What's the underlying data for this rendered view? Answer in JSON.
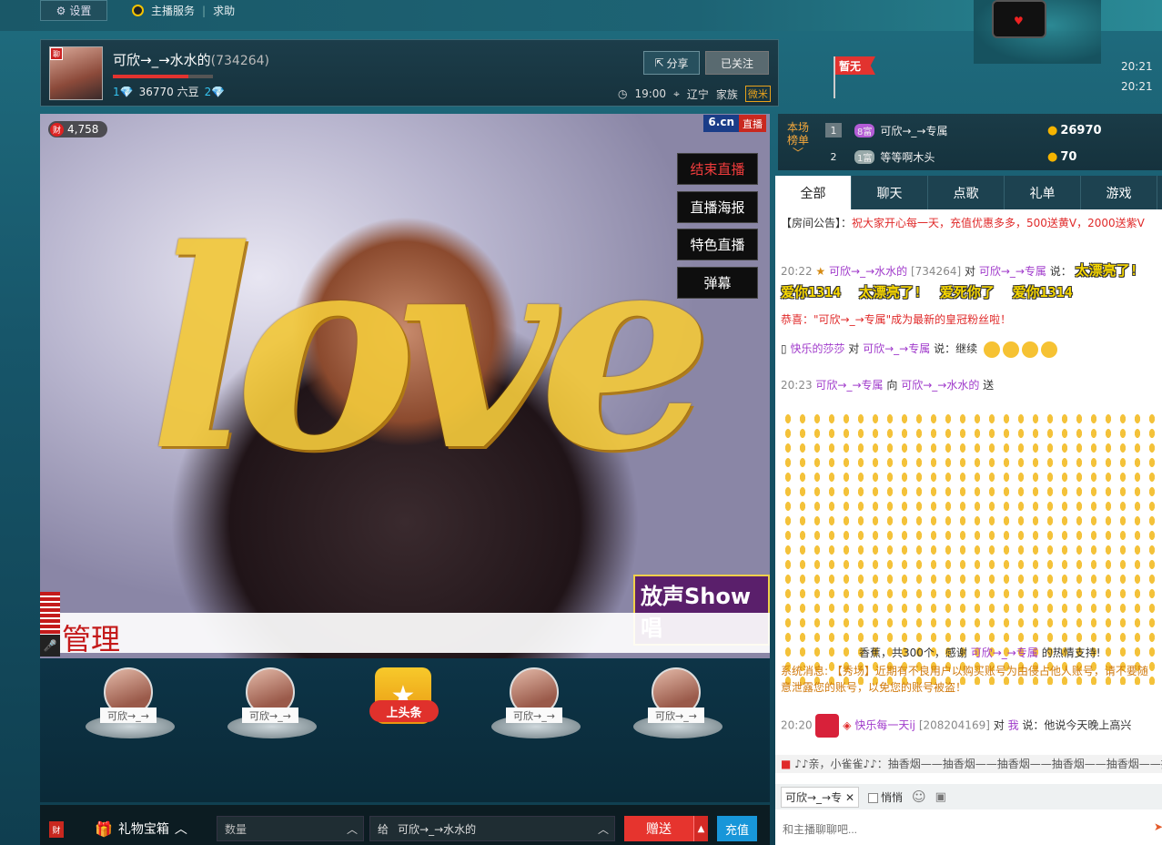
{
  "topbar": {
    "settings_label": "设置",
    "links": [
      "主播服务",
      "求助"
    ]
  },
  "host": {
    "avatar_badge": "聊",
    "name": "可欣→_→水水的",
    "id": "(734264)",
    "level_progress": 0.75,
    "beans": "36770 六豆",
    "share_label": "分享",
    "follow_label": "已关注",
    "time": "19:00",
    "location": "辽宁",
    "family_label": "家族",
    "family_tag": "微米"
  },
  "status": {
    "flag": "暂无",
    "times": [
      "20:21",
      "20:21"
    ]
  },
  "video": {
    "wealth_icon": "财",
    "wealth": "4,758",
    "site": "6.cn",
    "live_tag": "直播",
    "buttons": [
      "结束直播",
      "直播海报",
      "特色直播",
      "弹幕"
    ],
    "overlay_word": "love",
    "manage_text": "管理",
    "show_logo": "放声Show唱"
  },
  "seats": {
    "labels": [
      "可欣→_→",
      "可欣→_→",
      "可欣→_→",
      "可欣→_→"
    ],
    "headline": "上头条"
  },
  "giftbar": {
    "red_icon": "财",
    "box_label": "礼物宝箱",
    "qty_placeholder": "数量",
    "to_prefix": "给",
    "to_target": "可欣→_→水水的",
    "send_label": "赠送",
    "charge_label": "充值"
  },
  "rank": {
    "title": "本场榜单",
    "rows": [
      {
        "no": "1",
        "vip": "8富",
        "name": "可欣→_→专属",
        "value": "26970"
      },
      {
        "no": "2",
        "vip": "1富",
        "name": "等等啊木头",
        "value": "70"
      }
    ]
  },
  "chat": {
    "tabs": [
      "全部",
      "聊天",
      "点歌",
      "礼单",
      "游戏"
    ],
    "notice_prefix": "【房间公告】：",
    "notice": "祝大家开心每一天，充值优惠多多，500送黄V，2000送紫V",
    "msg1": {
      "time": "20:22",
      "from": "可欣→_→水水的",
      "from_id": "[734264]",
      "to_word": "对",
      "to": "可欣→_→专属",
      "say": "说：",
      "text1": "太漂亮了!",
      "line2": [
        "爱你1314",
        "太漂亮了!",
        "爱死你了",
        "爱你1314"
      ]
    },
    "crown_msg": "恭喜：\"可欣→_→专属\"成为最新的皇冠粉丝啦！",
    "msg2": {
      "from": "快乐的莎莎",
      "to_word": "对",
      "to": "可欣→_→专属",
      "say": "说：继续"
    },
    "gift_msg": {
      "time": "20:23",
      "from": "可欣→_→专属",
      "to_word": "向",
      "to": "可欣→_→水水的",
      "send": "送"
    },
    "gift_summary": {
      "item": "香蕉，共300个，感谢",
      "who": "可欣→_→专属",
      "tail": "的热情支持!"
    },
    "system_msg": "系统消息: 【秀场】近期有不良用户以购买账号为由侵占他人账号，请不要随意泄露您的账号，以免您的账号被盗！",
    "msg3": {
      "time": "20:20",
      "from": "快乐每一天ij",
      "from_id": "[208204169]",
      "to_word": "对",
      "to": "我",
      "say": "说：他说今天晚上高兴"
    },
    "marquee": "♪♪亲，小雀雀♪♪：抽香烟——抽香烟——抽香烟——抽香烟——抽香烟——抽香烟",
    "to_chip": "可欣→_→专",
    "whisper_label": "悄悄",
    "input_placeholder": "和主播聊聊吧..."
  },
  "colors": {
    "accent_red": "#e6342e",
    "charge_blue": "#1896d9",
    "rank_gold": "#f8a93b"
  }
}
